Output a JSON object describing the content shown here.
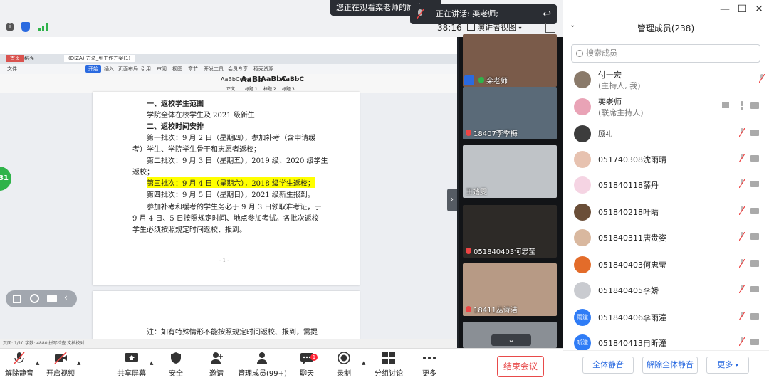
{
  "share_banner": "您正在观看栾老师的屏幕",
  "speaking": {
    "label": "正在讲话: 栾老师;"
  },
  "toolbar": {
    "timer": "38:16",
    "view_label": "演讲者视图"
  },
  "document": {
    "tabs": [
      "首页",
      "稻壳",
      "(DIZA) 方法_到工作方案(1)"
    ],
    "menu": [
      "文件",
      "开始",
      "插入",
      "页面布局",
      "引用",
      "审阅",
      "视图",
      "章节",
      "开发工具",
      "会员专享",
      "稻壳资源"
    ],
    "style_samples": [
      "AaBbCcDd",
      "AaBb",
      "AaBbC",
      "AaBbC"
    ],
    "style_names": [
      "正文",
      "标题 1",
      "标题 2",
      "标题 3"
    ],
    "lines": [
      "一、返校学生范围",
      "学院全体在校学生及 2021 级新生",
      "二、返校时间安排",
      "第一批次：9 月 2 日（星期四），参加补考（含申请缓",
      "考）学生、学院学生骨干和志愿者返校；",
      "第二批次：9 月 3 日（星期五），2019 级、2020 级学生",
      "返校；",
      "第三批次：9 月 4 日（星期六），2018 级学生返校；",
      "第四批次：9 月 5 日（星期日），2021 级新生报到。",
      "参加补考和缓考的学生务必于 9 月 3 日领取准考证，于",
      "9 月 4 日、5 日按照规定时间、地点参加考试。各批次返校",
      "学生必须按照规定时间返校、报到。",
      "- 1 -",
      "注：如有特殊情形不能按照规定时间返校、报到，需提"
    ],
    "status": "页面: 1/10    字数: 4880    拼写检查    文档校对"
  },
  "green_dot": "31",
  "videos": [
    {
      "name": "栾老师",
      "color": "#7a5b4a"
    },
    {
      "name": "18407李季梅",
      "color": "#5a6a78"
    },
    {
      "name": "王嫱雯",
      "color": "#bfc3c7"
    },
    {
      "name": "051840403何忠莹",
      "color": "#2d2a27"
    },
    {
      "name": "18411丛诗洁",
      "color": "#b79a85"
    },
    {
      "name": "",
      "color": "#8a8f95"
    }
  ],
  "members_panel": {
    "title": "管理成员(238)",
    "search_placeholder": "搜索成员",
    "members": [
      {
        "name": "付一宏",
        "role": "(主持人, 我)",
        "avatar_color": "#8a7a6a",
        "avatar_text": ""
      },
      {
        "name": "栾老师",
        "role": "(联席主持人)",
        "avatar_color": "#e9a3b6",
        "avatar_text": ""
      },
      {
        "name": "顾礼",
        "role": "",
        "avatar_color": "#3c3c3c",
        "avatar_text": ""
      },
      {
        "name": "051740308沈雨晴",
        "role": "",
        "avatar_color": "#e7c2b0",
        "avatar_text": ""
      },
      {
        "name": "051840118薛丹",
        "role": "",
        "avatar_color": "#f5d4e3",
        "avatar_text": ""
      },
      {
        "name": "051840218叶晴",
        "role": "",
        "avatar_color": "#6a4e38",
        "avatar_text": ""
      },
      {
        "name": "051840311唐贵姿",
        "role": "",
        "avatar_color": "#d9b89f",
        "avatar_text": ""
      },
      {
        "name": "051840403何忠莹",
        "role": "",
        "avatar_color": "#e36c2a",
        "avatar_text": ""
      },
      {
        "name": "051840405李娇",
        "role": "",
        "avatar_color": "#c9cbd0",
        "avatar_text": ""
      },
      {
        "name": "051840406李雨潼",
        "role": "",
        "avatar_color": "#2f7cf6",
        "avatar_text": "雨潼"
      },
      {
        "name": "051840413冉昕潼",
        "role": "",
        "avatar_color": "#2f7cf6",
        "avatar_text": "昕潼"
      }
    ],
    "footer": {
      "mute_all": "全体静音",
      "unmute_all": "解除全体静音",
      "more": "更多"
    }
  },
  "bottom_bar": {
    "unmute": "解除静音",
    "start_video": "开启视频",
    "share_screen": "共享屏幕",
    "security": "安全",
    "invite": "邀请",
    "manage_members": "管理成员(99+)",
    "chat": "聊天",
    "chat_badge": "1",
    "record": "录制",
    "breakout": "分组讨论",
    "more": "更多",
    "end_meeting": "结束会议"
  }
}
